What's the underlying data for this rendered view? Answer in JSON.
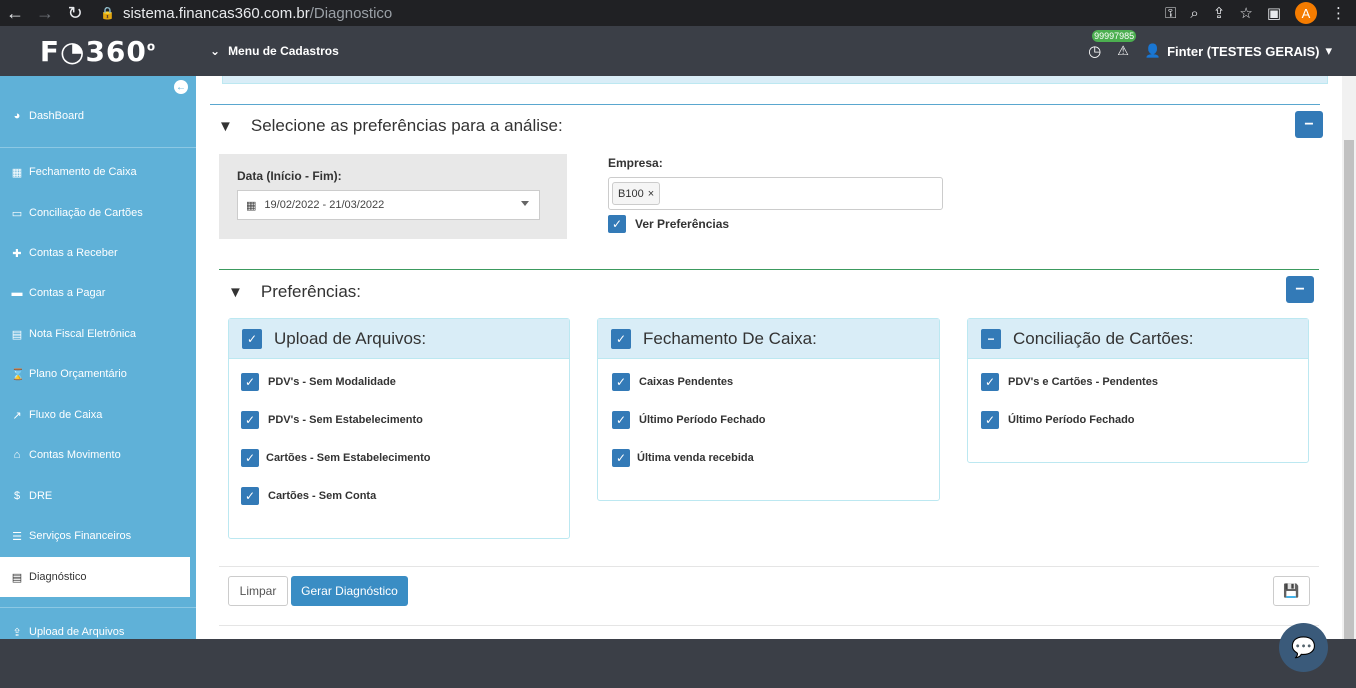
{
  "browser": {
    "url_host": "sistema.financas360.com.br",
    "url_path": "/Diagnostico",
    "profile_initial": "A"
  },
  "topbar": {
    "logo_main": "F",
    "logo_num": "360",
    "logo_sup": "o",
    "menu_label": "Menu de Cadastros",
    "notif_count": "99997985",
    "user_label": "Finter (TESTES GERAIS)"
  },
  "sidebar": {
    "items": [
      {
        "label": "DashBoard",
        "icon": "dashboard-icon"
      },
      {
        "label": "Fechamento de Caixa",
        "icon": "calendar-icon"
      },
      {
        "label": "Conciliação de Cartões",
        "icon": "credit-card-icon"
      },
      {
        "label": "Contas a Receber",
        "icon": "plus-icon"
      },
      {
        "label": "Contas a Pagar",
        "icon": "minus-icon"
      },
      {
        "label": "Nota Fiscal Eletrônica",
        "icon": "invoice-icon"
      },
      {
        "label": "Plano Orçamentário",
        "icon": "hourglass-icon"
      },
      {
        "label": "Fluxo de Caixa",
        "icon": "chart-icon"
      },
      {
        "label": "Contas Movimento",
        "icon": "bank-icon"
      },
      {
        "label": "DRE",
        "icon": "dollar-icon"
      },
      {
        "label": "Serviços Financeiros",
        "icon": "list-icon"
      },
      {
        "label": "Diagnóstico",
        "icon": "document-icon"
      },
      {
        "label": "Upload de Arquivos",
        "icon": "upload-icon"
      }
    ]
  },
  "filters": {
    "title": "Selecione as preferências para a análise:",
    "date_label": "Data (Início - Fim):",
    "date_value": "19/02/2022 - 21/03/2022",
    "empresa_label": "Empresa:",
    "empresa_tag": "B100",
    "tag_remove": "×",
    "ver_pref_label": "Ver Preferências"
  },
  "preferences": {
    "title": "Preferências:",
    "cards": [
      {
        "title": "Upload de Arquivos:",
        "items": [
          "PDV's - Sem Modalidade",
          "PDV's - Sem Estabelecimento",
          "Cartões - Sem Estabelecimento",
          "Cartões - Sem Conta"
        ]
      },
      {
        "title": "Fechamento De Caixa:",
        "items": [
          "Caixas Pendentes",
          "Último Período Fechado",
          "Última venda recebida"
        ]
      },
      {
        "title": "Conciliação de Cartões:",
        "items": [
          "PDV's e Cartões - Pendentes",
          "Último Período Fechado"
        ]
      }
    ]
  },
  "actions": {
    "limpar": "Limpar",
    "gerar": "Gerar Diagnóstico"
  },
  "colors": {
    "sidebar": "#5fb1d8",
    "primary": "#337ab7",
    "topbar": "#3b3f47"
  }
}
